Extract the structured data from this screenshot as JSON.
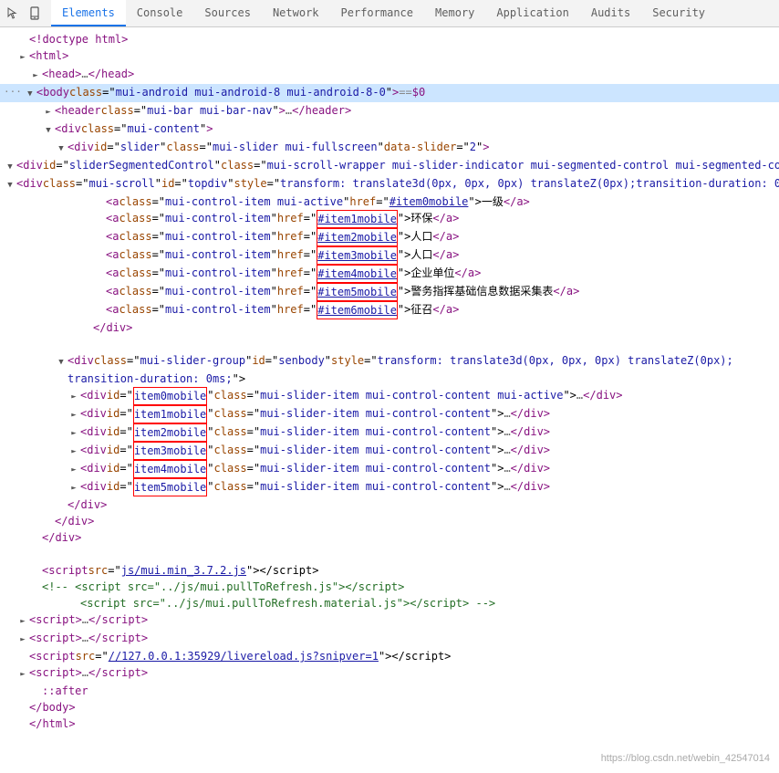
{
  "tabs": [
    {
      "label": "Elements",
      "active": true
    },
    {
      "label": "Console",
      "active": false
    },
    {
      "label": "Sources",
      "active": false
    },
    {
      "label": "Network",
      "active": false
    },
    {
      "label": "Performance",
      "active": false
    },
    {
      "label": "Memory",
      "active": false
    },
    {
      "label": "Application",
      "active": false
    },
    {
      "label": "Audits",
      "active": false
    },
    {
      "label": "Security",
      "active": false
    }
  ],
  "watermark": "https://blog.csdn.net/webin_42547014"
}
